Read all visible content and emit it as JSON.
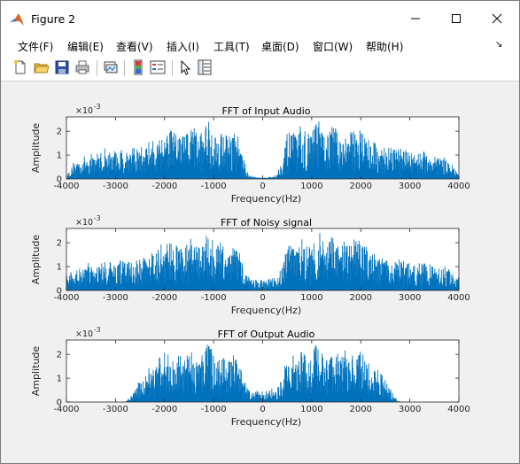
{
  "window": {
    "title": "Figure 2",
    "minimize_glyph": "minimize-icon",
    "maximize_glyph": "maximize-icon",
    "close_glyph": "close-icon"
  },
  "menubar": {
    "items": [
      "文件(F)",
      "编辑(E)",
      "查看(V)",
      "插入(I)",
      "工具(T)",
      "桌面(D)",
      "窗口(W)",
      "帮助(H)"
    ],
    "overflow_arrow": "↘"
  },
  "toolbar": {
    "icons": [
      "new-figure-icon",
      "open-file-icon",
      "save-icon",
      "print-icon",
      "link-plot-icon",
      "insert-colorbar-icon",
      "insert-legend-icon",
      "edit-plot-icon",
      "property-inspector-icon"
    ]
  },
  "colors": {
    "signal": "#0072bd",
    "axes_bg": "#ffffff",
    "figure_bg": "#f0f0f0"
  },
  "chart_data": [
    {
      "type": "line",
      "title": "FFT of Input Audio",
      "xlabel": "Frequency(Hz)",
      "ylabel": "Amplitude",
      "y_exponent": "× 10^-3",
      "xlim": [
        -4000,
        4000
      ],
      "ylim": [
        0,
        2.6
      ],
      "xticks": [
        "-4000",
        "-3000",
        "-2000",
        "-1000",
        "0",
        "1000",
        "2000",
        "3000",
        "4000"
      ],
      "yticks": [
        "0",
        "1",
        "2"
      ],
      "series": [
        {
          "color": "#0072bd",
          "envelope_x": [
            -4000,
            -3800,
            -3600,
            -3400,
            -3200,
            -3000,
            -2800,
            -2600,
            -2400,
            -2200,
            -2000,
            -1800,
            -1600,
            -1400,
            -1300,
            -1200,
            -1100,
            -1000,
            -900,
            -800,
            -700,
            -600,
            -500,
            -400,
            -300,
            -200,
            0,
            200,
            300,
            400,
            500,
            600,
            700,
            800,
            900,
            1000,
            1100,
            1200,
            1300,
            1400,
            1600,
            1800,
            2000,
            2200,
            2400,
            2600,
            2800,
            3000,
            3200,
            3400,
            3600,
            3800,
            4000
          ],
          "envelope_y": [
            0.15,
            0.8,
            1.0,
            1.1,
            1.2,
            1.2,
            1.3,
            1.3,
            1.4,
            1.7,
            2.2,
            2.0,
            1.9,
            2.3,
            1.8,
            2.2,
            2.6,
            2.0,
            1.9,
            2.3,
            1.8,
            2.0,
            1.9,
            0.9,
            0.3,
            0.1,
            0.05,
            0.1,
            0.3,
            0.9,
            1.9,
            2.0,
            1.8,
            2.3,
            1.9,
            2.0,
            2.6,
            2.2,
            1.8,
            2.3,
            1.9,
            2.0,
            2.2,
            1.7,
            1.4,
            1.3,
            1.3,
            1.2,
            1.2,
            1.1,
            1.0,
            0.8,
            0.15
          ]
        }
      ]
    },
    {
      "type": "line",
      "title": "FFT of Noisy signal",
      "xlabel": "Frequency(Hz)",
      "ylabel": "Amplitude",
      "y_exponent": "× 10^-3",
      "xlim": [
        -4000,
        4000
      ],
      "ylim": [
        0,
        2.6
      ],
      "xticks": [
        "-4000",
        "-3000",
        "-2000",
        "-1000",
        "0",
        "1000",
        "2000",
        "3000",
        "4000"
      ],
      "yticks": [
        "0",
        "1",
        "2"
      ],
      "series": [
        {
          "color": "#0072bd",
          "envelope_x": [
            -4000,
            -3800,
            -3600,
            -3400,
            -3200,
            -3000,
            -2800,
            -2600,
            -2400,
            -2200,
            -2000,
            -1800,
            -1600,
            -1400,
            -1300,
            -1200,
            -1100,
            -1000,
            -900,
            -800,
            -700,
            -600,
            -500,
            -400,
            -300,
            -200,
            0,
            200,
            300,
            400,
            500,
            600,
            700,
            800,
            900,
            1000,
            1100,
            1200,
            1300,
            1400,
            1600,
            1800,
            2000,
            2200,
            2400,
            2600,
            2800,
            3000,
            3200,
            3400,
            3600,
            3800,
            4000
          ],
          "envelope_y": [
            0.6,
            0.9,
            1.0,
            1.1,
            1.2,
            1.2,
            1.3,
            1.3,
            1.4,
            1.7,
            2.2,
            2.0,
            1.9,
            2.3,
            1.8,
            2.2,
            2.6,
            2.0,
            1.9,
            2.3,
            1.8,
            2.0,
            1.9,
            1.0,
            0.6,
            0.5,
            0.45,
            0.5,
            0.6,
            1.0,
            1.9,
            2.0,
            1.8,
            2.3,
            1.9,
            2.0,
            2.6,
            2.2,
            1.8,
            2.3,
            1.9,
            2.0,
            2.2,
            1.7,
            1.4,
            1.3,
            1.3,
            1.2,
            1.2,
            1.1,
            1.0,
            0.9,
            0.6
          ]
        }
      ]
    },
    {
      "type": "line",
      "title": "FFT of Output Audio",
      "xlabel": "Frequency(Hz)",
      "ylabel": "Amplitude",
      "y_exponent": "× 10^-3",
      "xlim": [
        -4000,
        4000
      ],
      "ylim": [
        0,
        2.6
      ],
      "xticks": [
        "-4000",
        "-3000",
        "-2000",
        "-1000",
        "0",
        "1000",
        "2000",
        "3000",
        "4000"
      ],
      "yticks": [
        "0",
        "1",
        "2"
      ],
      "series": [
        {
          "color": "#0072bd",
          "envelope_x": [
            -4000,
            -3000,
            -2800,
            -2700,
            -2600,
            -2400,
            -2200,
            -2000,
            -1800,
            -1600,
            -1400,
            -1300,
            -1200,
            -1100,
            -1000,
            -900,
            -800,
            -700,
            -600,
            -500,
            -400,
            -300,
            -200,
            0,
            200,
            300,
            400,
            500,
            600,
            700,
            800,
            900,
            1000,
            1100,
            1200,
            1300,
            1400,
            1600,
            1800,
            2000,
            2200,
            2400,
            2600,
            2700,
            2800,
            3000,
            4000
          ],
          "envelope_y": [
            0.0,
            0.0,
            0.02,
            0.2,
            0.6,
            1.3,
            1.6,
            2.2,
            2.0,
            1.9,
            2.3,
            1.8,
            2.2,
            2.6,
            2.0,
            1.9,
            2.3,
            1.8,
            2.0,
            1.9,
            1.0,
            0.6,
            0.5,
            0.45,
            0.5,
            0.6,
            1.0,
            1.9,
            2.0,
            1.8,
            2.3,
            1.9,
            2.0,
            2.6,
            2.2,
            1.8,
            2.3,
            1.9,
            2.0,
            2.2,
            1.6,
            1.3,
            0.6,
            0.2,
            0.02,
            0.0,
            0.0
          ]
        }
      ]
    }
  ]
}
